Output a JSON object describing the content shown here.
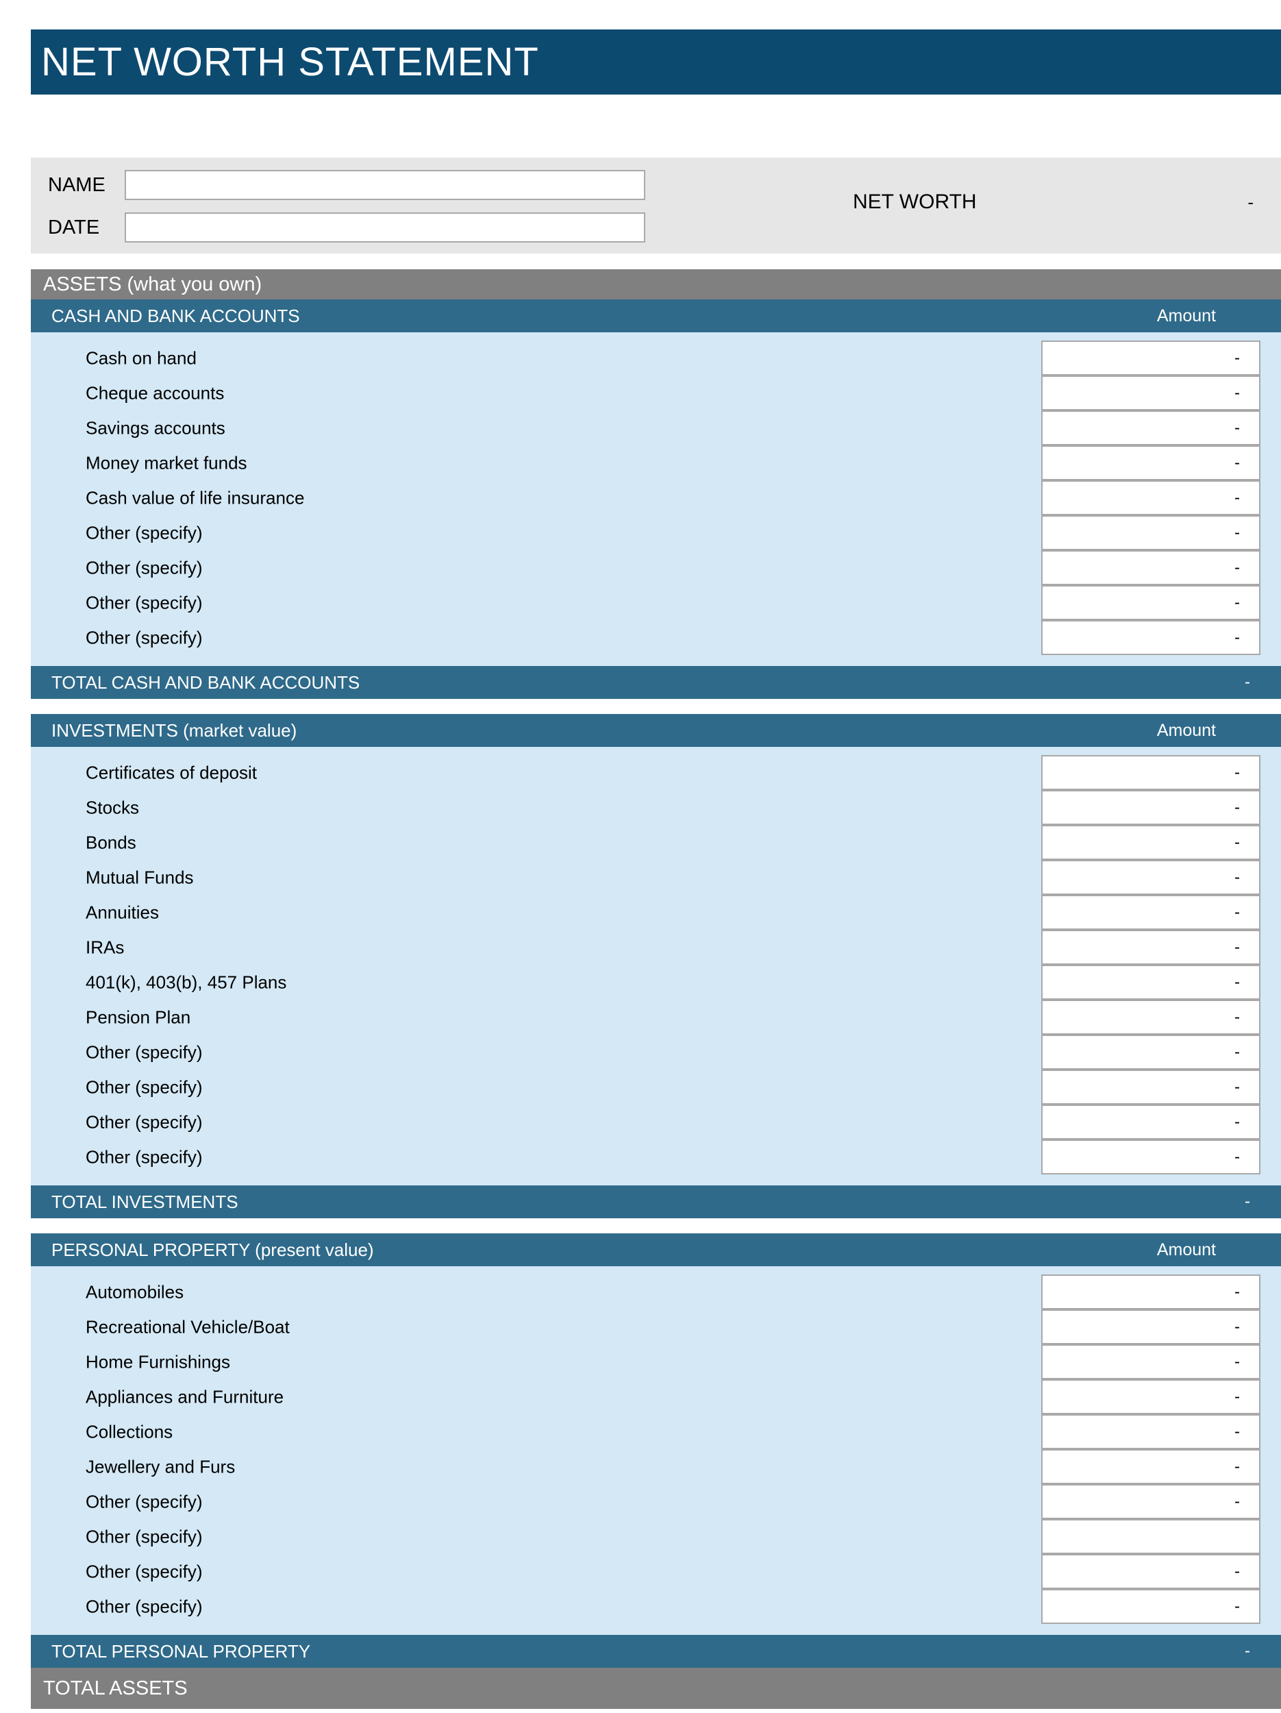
{
  "document": {
    "title": "NET WORTH STATEMENT"
  },
  "colors": {
    "title_bar": "#0d4a70",
    "assets_band": "#808080",
    "section_header": "#2f6a8a",
    "total_band": "#2f6a8a",
    "item_background": "#d4e8f5",
    "info_panel": "#e6e6e6"
  },
  "info": {
    "name_label": "NAME",
    "name_value": "",
    "date_label": "DATE",
    "date_value": "",
    "networth_label": "NET WORTH",
    "networth_value": "-"
  },
  "assets_header": {
    "title": "ASSETS",
    "subtitle": "(what you own)"
  },
  "amount_column_header": "Amount",
  "sections": [
    {
      "id": "cash-and-bank-accounts",
      "header": "CASH AND BANK ACCOUNTS",
      "amount_header": "Amount",
      "items": [
        {
          "label": "Cash on hand",
          "amount": "-"
        },
        {
          "label": "Cheque accounts",
          "amount": "-"
        },
        {
          "label": "Savings accounts",
          "amount": "-"
        },
        {
          "label": "Money market funds",
          "amount": "-"
        },
        {
          "label": "Cash value of life insurance",
          "amount": "-"
        },
        {
          "label": "Other (specify)",
          "amount": "-"
        },
        {
          "label": "Other (specify)",
          "amount": "-"
        },
        {
          "label": "Other (specify)",
          "amount": "-"
        },
        {
          "label": "Other (specify)",
          "amount": "-"
        }
      ],
      "total_label": "TOTAL CASH AND BANK ACCOUNTS",
      "total_value": "-"
    },
    {
      "id": "investments",
      "header": "INVESTMENTS (market value)",
      "amount_header": "Amount",
      "items": [
        {
          "label": "Certificates of deposit",
          "amount": "-"
        },
        {
          "label": "Stocks",
          "amount": "-"
        },
        {
          "label": "Bonds",
          "amount": "-"
        },
        {
          "label": "Mutual Funds",
          "amount": "-"
        },
        {
          "label": "Annuities",
          "amount": "-"
        },
        {
          "label": "IRAs",
          "amount": "-"
        },
        {
          "label": "401(k), 403(b), 457 Plans",
          "amount": "-"
        },
        {
          "label": "Pension Plan",
          "amount": "-"
        },
        {
          "label": "Other (specify)",
          "amount": "-"
        },
        {
          "label": "Other (specify)",
          "amount": "-"
        },
        {
          "label": "Other (specify)",
          "amount": "-"
        },
        {
          "label": "Other (specify)",
          "amount": "-"
        }
      ],
      "total_label": "TOTAL INVESTMENTS",
      "total_value": "-"
    },
    {
      "id": "personal-property",
      "header": "PERSONAL PROPERTY (present value)",
      "amount_header": "Amount",
      "items": [
        {
          "label": "Automobiles",
          "amount": "-"
        },
        {
          "label": "Recreational Vehicle/Boat",
          "amount": "-"
        },
        {
          "label": "Home Furnishings",
          "amount": "-"
        },
        {
          "label": "Appliances and Furniture",
          "amount": "-"
        },
        {
          "label": "Collections",
          "amount": "-"
        },
        {
          "label": "Jewellery and Furs",
          "amount": "-"
        },
        {
          "label": "Other (specify)",
          "amount": "-"
        },
        {
          "label": "Other (specify)",
          "amount": ""
        },
        {
          "label": "Other (specify)",
          "amount": "-"
        },
        {
          "label": "Other (specify)",
          "amount": "-"
        }
      ],
      "total_label": "TOTAL PERSONAL PROPERTY",
      "total_value": "-"
    }
  ],
  "total_assets": {
    "label": "TOTAL ASSETS"
  }
}
